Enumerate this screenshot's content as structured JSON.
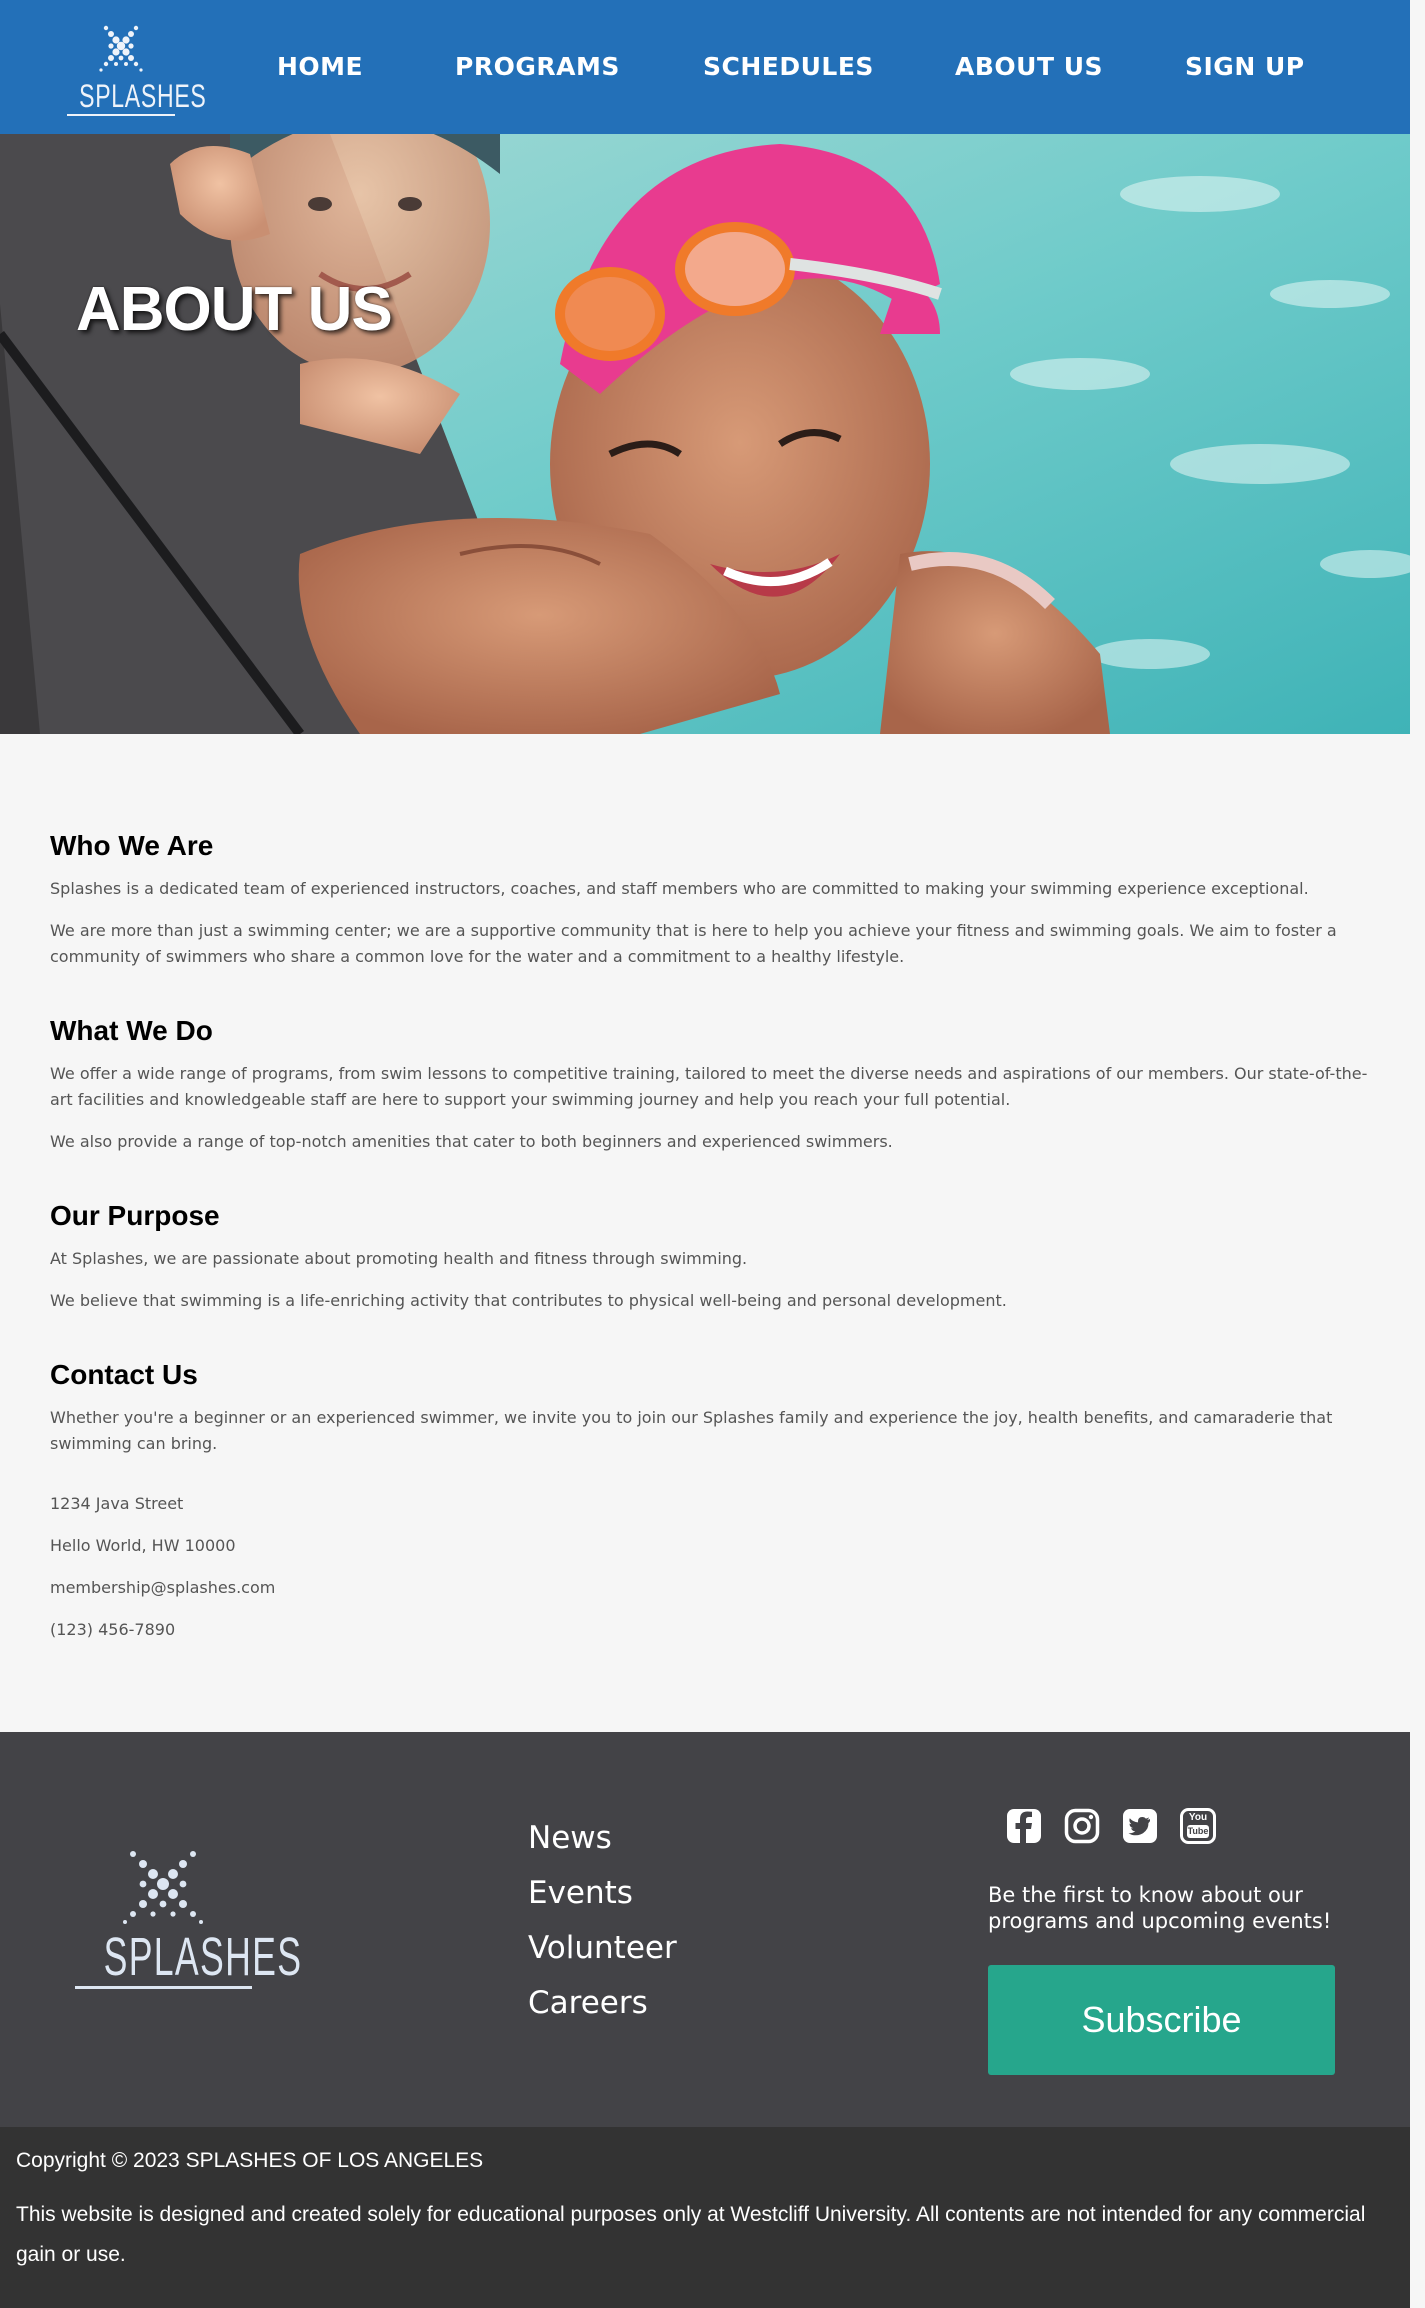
{
  "header": {
    "logo_text": "SPLASHES",
    "nav": [
      "HOME",
      "PROGRAMS",
      "SCHEDULES",
      "ABOUT US",
      "SIGN UP"
    ]
  },
  "hero": {
    "title": "ABOUT US"
  },
  "sections": {
    "who": {
      "heading": "Who We Are",
      "p1": "Splashes is a dedicated team of experienced instructors, coaches, and staff members who are committed to making your swimming experience exceptional.",
      "p2": "We are more than just a swimming center; we are a supportive community that is here to help you achieve your fitness and swimming goals. We aim to foster a community of swimmers who share a common love for the water and a commitment to a healthy lifestyle."
    },
    "what": {
      "heading": "What We Do",
      "p1": "We offer a wide range of programs, from swim lessons to competitive training, tailored to meet the diverse needs and aspirations of our members. Our state-of-the-art facilities and knowledgeable staff are here to support your swimming journey and help you reach your full potential.",
      "p2": "We also provide a range of top-notch amenities that cater to both beginners and experienced swimmers."
    },
    "purpose": {
      "heading": "Our Purpose",
      "p1": "At Splashes, we are passionate about promoting health and fitness through swimming.",
      "p2": "We believe that swimming is a life-enriching activity that contributes to physical well-being and personal development."
    },
    "contact": {
      "heading": "Contact Us",
      "p1": "Whether you're a beginner or an experienced swimmer, we invite you to join our Splashes family and experience the joy, health benefits, and camaraderie that swimming can bring.",
      "address1": "1234 Java Street",
      "address2": "Hello World, HW 10000",
      "email": "membership@splashes.com",
      "phone": "(123) 456-7890"
    }
  },
  "footer": {
    "logo_text": "SPLASHES",
    "links": [
      "News",
      "Events",
      "Volunteer",
      "Careers"
    ],
    "social_icons": [
      "facebook-icon",
      "instagram-icon",
      "twitter-icon",
      "youtube-icon"
    ],
    "youtube_label_top": "You",
    "youtube_label_bottom": "Tube",
    "tagline": "Be the first to know about our programs and upcoming events!",
    "subscribe_label": "Subscribe",
    "copyright": "Copyright © 2023 SPLASHES OF LOS ANGELES",
    "disclaimer": "This website is designed and created solely for educational purposes only at Westcliff University. All contents are not intended for any commercial gain or use."
  },
  "colors": {
    "header_bg": "#2370b8",
    "footer_bg": "#434347",
    "copyright_bg": "#333333",
    "subscribe_bg": "#26a68c",
    "page_bg": "#f6f6f6"
  }
}
